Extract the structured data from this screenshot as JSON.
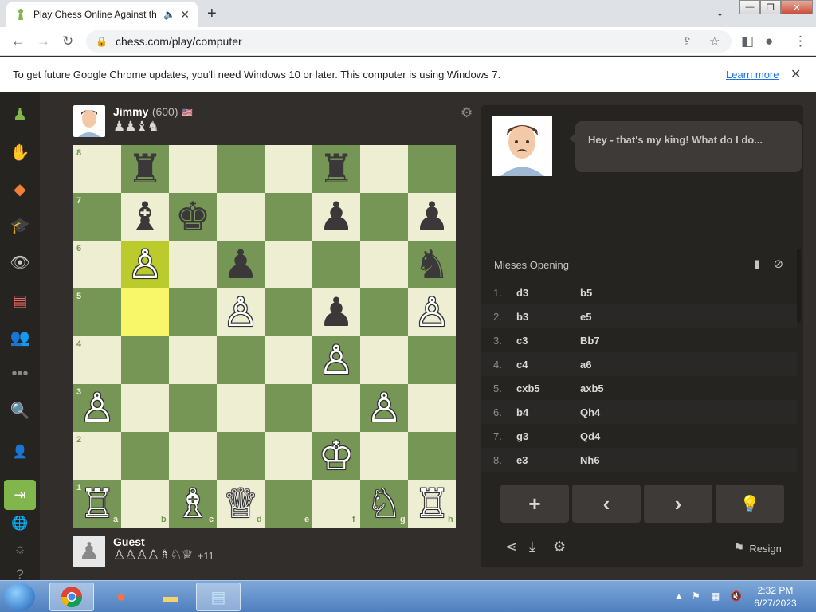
{
  "browser": {
    "tab_title": "Play Chess Online Against th",
    "url": "chess.com/play/computer",
    "infobar_message": "To get future Google Chrome updates, you'll need Windows 10 or later. This computer is using Windows 7.",
    "infobar_link": "Learn more"
  },
  "opponent": {
    "name": "Jimmy",
    "rating": "(600)",
    "captured": "♟♟♝♞"
  },
  "player": {
    "name": "Guest",
    "captured": "♙♙♙♙♗♘♕",
    "advantage": "+11"
  },
  "board": {
    "ranks": [
      "8",
      "7",
      "6",
      "5",
      "4",
      "3",
      "2",
      "1"
    ],
    "files": [
      "a",
      "b",
      "c",
      "d",
      "e",
      "f",
      "g",
      "h"
    ],
    "highlight": [
      "b6",
      "b5"
    ],
    "pieces": [
      {
        "sq": "b8",
        "p": "♜",
        "c": "b"
      },
      {
        "sq": "f8",
        "p": "♜",
        "c": "b"
      },
      {
        "sq": "b7",
        "p": "♝",
        "c": "b"
      },
      {
        "sq": "c7",
        "p": "♚",
        "c": "b"
      },
      {
        "sq": "f7",
        "p": "♟",
        "c": "b"
      },
      {
        "sq": "h7",
        "p": "♟",
        "c": "b"
      },
      {
        "sq": "b6",
        "p": "♙",
        "c": "w"
      },
      {
        "sq": "d6",
        "p": "♟",
        "c": "b"
      },
      {
        "sq": "h6",
        "p": "♞",
        "c": "b"
      },
      {
        "sq": "d5",
        "p": "♙",
        "c": "w"
      },
      {
        "sq": "f5",
        "p": "♟",
        "c": "b"
      },
      {
        "sq": "h5",
        "p": "♙",
        "c": "w"
      },
      {
        "sq": "f4",
        "p": "♙",
        "c": "w"
      },
      {
        "sq": "a3",
        "p": "♙",
        "c": "w"
      },
      {
        "sq": "g3",
        "p": "♙",
        "c": "w"
      },
      {
        "sq": "f2",
        "p": "♔",
        "c": "w"
      },
      {
        "sq": "a1",
        "p": "♖",
        "c": "w"
      },
      {
        "sq": "c1",
        "p": "♗",
        "c": "w"
      },
      {
        "sq": "d1",
        "p": "♕",
        "c": "w"
      },
      {
        "sq": "g1",
        "p": "♘",
        "c": "w"
      },
      {
        "sq": "h1",
        "p": "♖",
        "c": "w"
      }
    ]
  },
  "chat": {
    "message": "Hey - that's my king! What do I do..."
  },
  "opening": "Mieses Opening",
  "moves": [
    {
      "n": "1.",
      "w": "d3",
      "b": "b5"
    },
    {
      "n": "2.",
      "w": "b3",
      "b": "e5"
    },
    {
      "n": "3.",
      "w": "c3",
      "b": "Bb7"
    },
    {
      "n": "4.",
      "w": "c4",
      "b": "a6"
    },
    {
      "n": "5.",
      "w": "cxb5",
      "b": "axb5"
    },
    {
      "n": "6.",
      "w": "b4",
      "b": "Qh4"
    },
    {
      "n": "7.",
      "w": "g3",
      "b": "Qd4"
    },
    {
      "n": "8.",
      "w": "e3",
      "b": "Nh6"
    }
  ],
  "controls": {
    "resign_label": "Resign"
  },
  "taskbar": {
    "time": "2:32 PM",
    "date": "6/27/2023"
  }
}
